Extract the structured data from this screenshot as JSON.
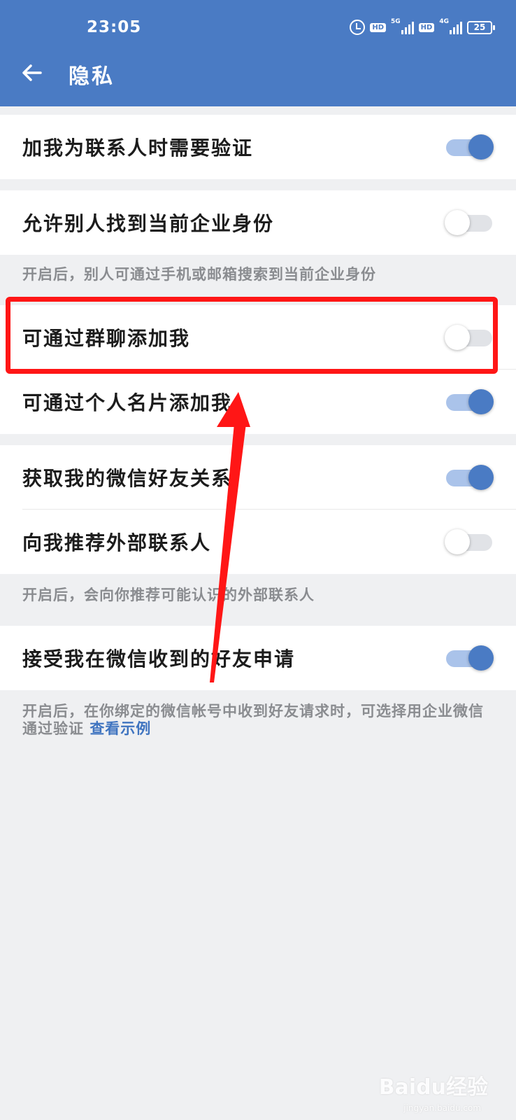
{
  "status_bar": {
    "time": "23:05",
    "hd1": "HD",
    "net1": "5G",
    "hd2": "HD",
    "net2": "4G",
    "battery": "25"
  },
  "header": {
    "title": "隐私",
    "back_icon": "arrow-left-icon"
  },
  "settings": {
    "verify_contact": {
      "label": "加我为联系人时需要验证",
      "on": true
    },
    "find_identity": {
      "label": "允许别人找到当前企业身份",
      "on": false,
      "hint": "开启后，别人可通过手机或邮箱搜索到当前企业身份"
    },
    "add_by_group": {
      "label": "可通过群聊添加我",
      "on": false
    },
    "add_by_card": {
      "label": "可通过个人名片添加我",
      "on": true
    },
    "wechat_friends": {
      "label": "获取我的微信好友关系",
      "on": true
    },
    "recommend_external": {
      "label": "向我推荐外部联系人",
      "on": false,
      "hint": "开启后，会向你推荐可能认识的外部联系人"
    },
    "accept_wechat_requests": {
      "label": "接受我在微信收到的好友申请",
      "on": true,
      "hint": "开启后，在你绑定的微信帐号中收到好友请求时，可选择用企业微信通过验证",
      "hint_link": "查看示例"
    }
  },
  "annotation_color": "#ff1616",
  "accent_color": "#4a7bc4",
  "watermark": {
    "text": "Baidu经验",
    "sub": "jingyan.baidu.com"
  }
}
